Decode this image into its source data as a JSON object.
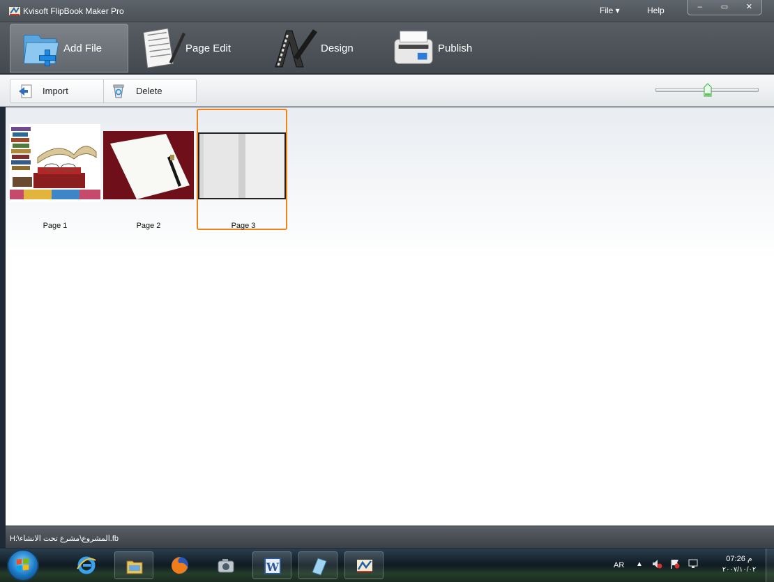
{
  "window": {
    "title": "Kvisoft FlipBook Maker Pro",
    "menu": {
      "file": "File ▾",
      "help": "Help"
    },
    "controls": {
      "minimize": "–",
      "maximize": "▭",
      "close": "✕"
    }
  },
  "ribbon": {
    "tabs": [
      {
        "label": "Add File",
        "icon": "add-file-icon",
        "active": true
      },
      {
        "label": "Page Edit",
        "icon": "page-edit-icon",
        "active": false
      },
      {
        "label": "Design",
        "icon": "design-icon",
        "active": false
      },
      {
        "label": "Publish",
        "icon": "publish-icon",
        "active": false
      }
    ]
  },
  "toolbar": {
    "import_label": "Import",
    "delete_label": "Delete",
    "zoom_level": 0.5
  },
  "pages": [
    {
      "caption": "Page 1",
      "selected": false
    },
    {
      "caption": "Page 2",
      "selected": false
    },
    {
      "caption": "Page 3",
      "selected": true
    }
  ],
  "status": {
    "path": "H:\\المشروع\\مشرع تحت الانشاء.fb"
  },
  "taskbar": {
    "lang": "AR",
    "tray_arrow": "▲",
    "time": "07:26 م",
    "date": "٢٠٠٧/١٠/٠٢",
    "apps": [
      "internet-explorer-icon",
      "file-explorer-icon",
      "firefox-icon",
      "camera-icon",
      "word-icon",
      "app-icon",
      "flipbook-icon"
    ]
  },
  "colors": {
    "accent": "#f0821e",
    "titlebar": "#4a5056",
    "taskbar": "#0f1a22"
  }
}
